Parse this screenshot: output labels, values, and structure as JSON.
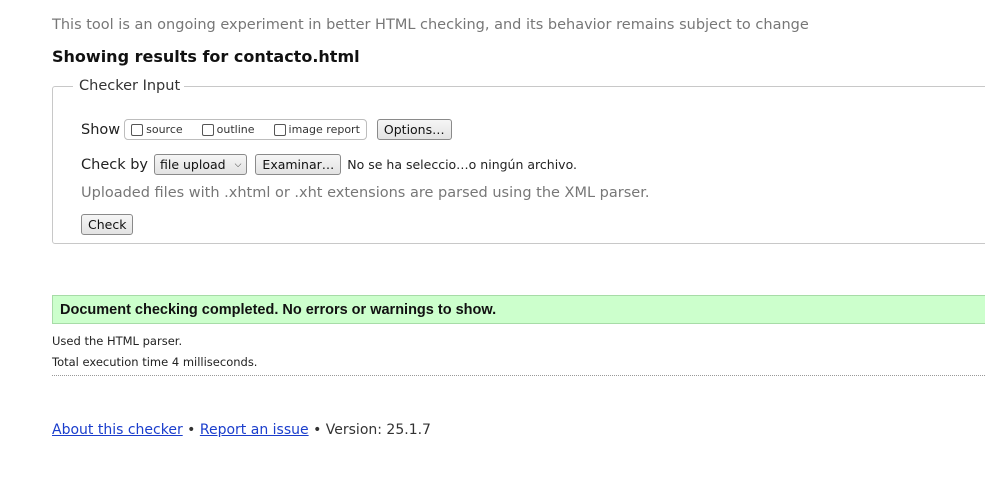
{
  "notice": "This tool is an ongoing experiment in better HTML checking, and its behavior remains subject to change",
  "results_heading": "Showing results for contacto.html",
  "checker_input": {
    "legend": "Checker Input",
    "show_label": "Show",
    "show_options": [
      {
        "label": "source",
        "checked": false
      },
      {
        "label": "outline",
        "checked": false
      },
      {
        "label": "image report",
        "checked": false
      }
    ],
    "options_button": "Options…",
    "check_by_label": "Check by",
    "check_by_select": "file upload",
    "browse_button": "Examinar…",
    "file_status": "No se ha seleccio…o ningún archivo.",
    "hint": "Uploaded files with .xhtml or .xht extensions are parsed using the XML parser.",
    "check_button": "Check"
  },
  "result": {
    "message": "Document checking completed. No errors or warnings to show.",
    "success_color": "#ccffcc"
  },
  "details": {
    "parser": "Used the HTML parser.",
    "timing": "Total execution time 4 milliseconds."
  },
  "footer": {
    "about_link": "About this checker",
    "separator": "•",
    "report_link": "Report an issue",
    "version": "Version: 25.1.7"
  },
  "colors": {
    "link": "#1a3dcc",
    "muted_text": "#777777"
  }
}
